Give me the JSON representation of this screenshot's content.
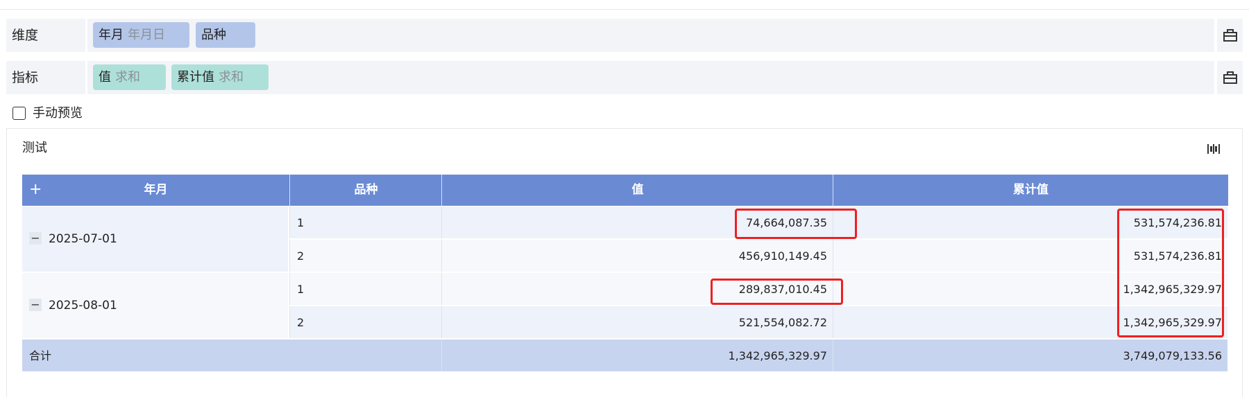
{
  "dimensions": {
    "label": "维度",
    "fields": [
      {
        "name": "年月",
        "sub": "年月日"
      },
      {
        "name": "品种",
        "sub": ""
      }
    ]
  },
  "metrics": {
    "label": "指标",
    "fields": [
      {
        "name": "值",
        "agg": "求和"
      },
      {
        "name": "累计值",
        "agg": "求和"
      }
    ]
  },
  "manual_preview": {
    "label": "手动预览",
    "checked": false
  },
  "panel": {
    "title": "测试"
  },
  "table": {
    "expand_symbol": "+",
    "collapse_symbol": "−",
    "headers": [
      "年月",
      "品种",
      "值",
      "累计值"
    ],
    "groups": [
      {
        "date": "2025-07-01",
        "rows": [
          {
            "variety": "1",
            "value": "74,664,087.35",
            "cumulative": "531,574,236.81"
          },
          {
            "variety": "2",
            "value": "456,910,149.45",
            "cumulative": "531,574,236.81"
          }
        ]
      },
      {
        "date": "2025-08-01",
        "rows": [
          {
            "variety": "1",
            "value": "289,837,010.45",
            "cumulative": "1,342,965,329.97"
          },
          {
            "variety": "2",
            "value": "521,554,082.72",
            "cumulative": "1,342,965,329.97"
          }
        ]
      }
    ],
    "total": {
      "label": "合计",
      "value": "1,342,965,329.97",
      "cumulative": "3,749,079,133.56"
    }
  },
  "colors": {
    "header": "#6a8bd4",
    "highlight": "#ee2020",
    "dim_pill": "#b3c6ea",
    "metric_pill": "#aee0da"
  },
  "icons": {
    "config_side": "briefcase-icon",
    "chart_settings": "chart-settings-icon"
  }
}
